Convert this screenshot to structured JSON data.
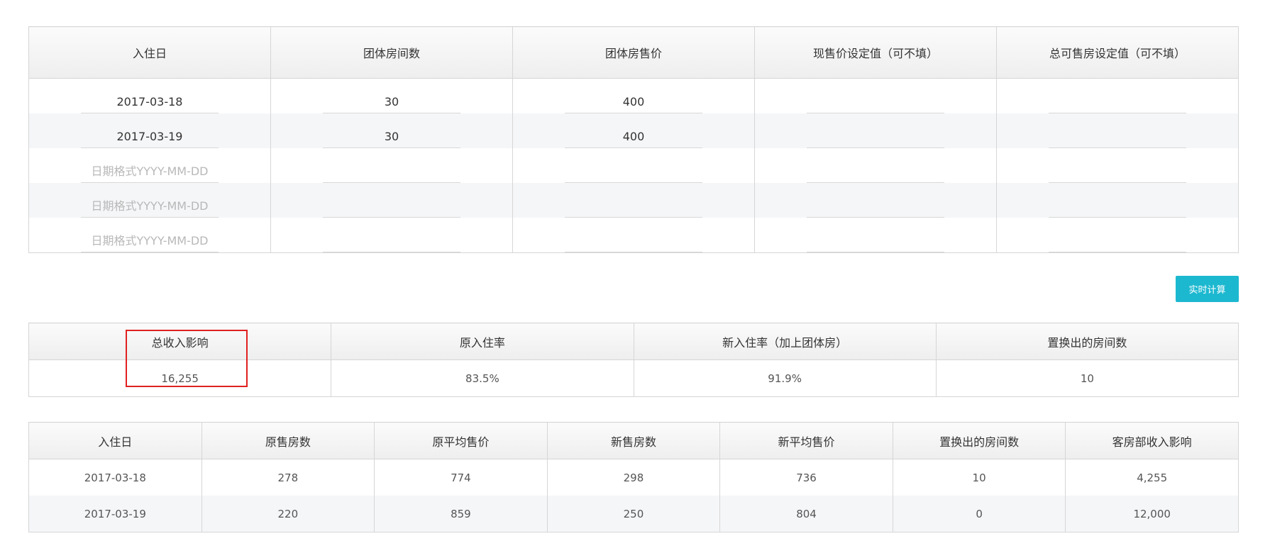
{
  "input_table": {
    "headers": [
      "入住日",
      "团体房间数",
      "团体房售价",
      "现售价设定值（可不填）",
      "总可售房设定值（可不填）"
    ],
    "date_placeholder": "日期格式YYYY-MM-DD",
    "rows": [
      [
        "2017-03-18",
        "30",
        "400",
        "",
        ""
      ],
      [
        "2017-03-19",
        "30",
        "400",
        "",
        ""
      ],
      [
        "",
        "",
        "",
        "",
        ""
      ],
      [
        "",
        "",
        "",
        "",
        ""
      ],
      [
        "",
        "",
        "",
        "",
        ""
      ]
    ]
  },
  "calc_button": {
    "label": "实时计算"
  },
  "summary_table": {
    "headers": [
      "总收入影响",
      "原入住率",
      "新入住率（加上团体房）",
      "置换出的房间数"
    ],
    "values": [
      "16,255",
      "83.5%",
      "91.9%",
      "10"
    ]
  },
  "detail_table": {
    "headers": [
      "入住日",
      "原售房数",
      "原平均售价",
      "新售房数",
      "新平均售价",
      "置换出的房间数",
      "客房部收入影响"
    ],
    "rows": [
      [
        "2017-03-18",
        "278",
        "774",
        "298",
        "736",
        "10",
        "4,255"
      ],
      [
        "2017-03-19",
        "220",
        "859",
        "250",
        "804",
        "0",
        "12,000"
      ]
    ]
  },
  "colors": {
    "accent": "#1cb8d0",
    "highlight": "#e02020",
    "row_alt": "#f5f6f8"
  }
}
